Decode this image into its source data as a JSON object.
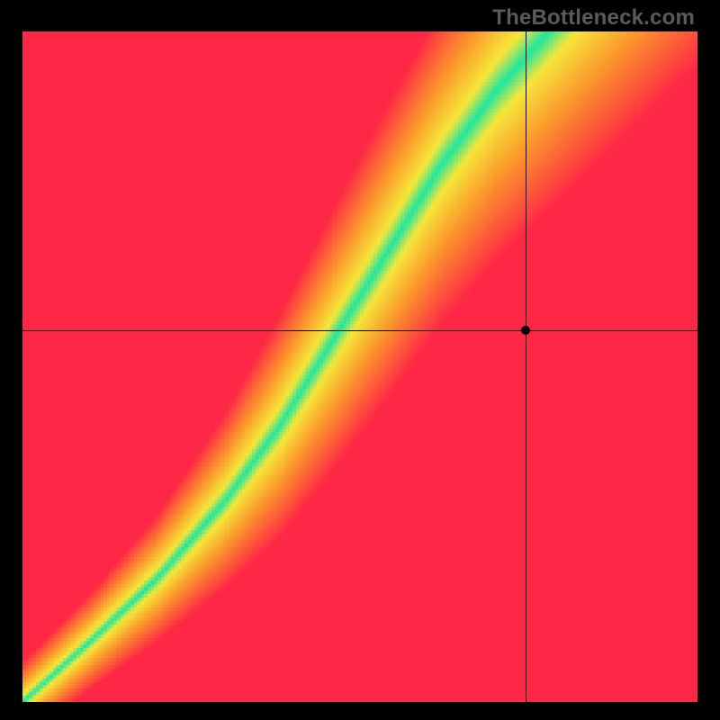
{
  "watermark": "TheBottleneck.com",
  "chart_data": {
    "type": "heatmap",
    "title": "",
    "xlabel": "",
    "ylabel": "",
    "xlim": [
      0,
      1
    ],
    "ylim": [
      0,
      1
    ],
    "crosshair": {
      "x": 0.745,
      "y": 0.555
    },
    "marker": {
      "x": 0.745,
      "y": 0.555
    },
    "ridge": {
      "description": "green optimal band; piecewise y(x) with half-width",
      "points": [
        {
          "x": 0.0,
          "y": 0.0,
          "w": 0.01
        },
        {
          "x": 0.1,
          "y": 0.09,
          "w": 0.012
        },
        {
          "x": 0.2,
          "y": 0.185,
          "w": 0.016
        },
        {
          "x": 0.3,
          "y": 0.3,
          "w": 0.022
        },
        {
          "x": 0.38,
          "y": 0.41,
          "w": 0.028
        },
        {
          "x": 0.46,
          "y": 0.54,
          "w": 0.033
        },
        {
          "x": 0.54,
          "y": 0.67,
          "w": 0.037
        },
        {
          "x": 0.62,
          "y": 0.8,
          "w": 0.04
        },
        {
          "x": 0.7,
          "y": 0.91,
          "w": 0.043
        },
        {
          "x": 0.78,
          "y": 1.0,
          "w": 0.045
        }
      ]
    },
    "palette": {
      "green": "#1fe6a0",
      "yellow": "#f6e73a",
      "orange": "#fb9a2c",
      "red": "#fe2745"
    }
  }
}
